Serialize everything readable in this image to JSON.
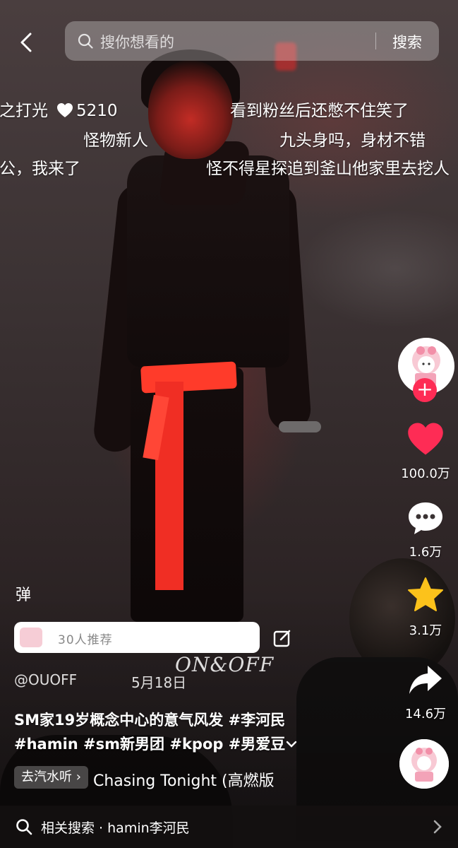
{
  "search": {
    "placeholder": "搜你想看的",
    "button_label": "搜索"
  },
  "danmaku": [
    {
      "text": "神之打光",
      "likes": "5210"
    },
    {
      "text": "看到粉丝后还憋不住笑了"
    },
    {
      "text": "怪物新人"
    },
    {
      "text": "九头身吗，身材不错"
    },
    {
      "text": "老公，我来了"
    },
    {
      "text": "怪不得星探追到釜山他家里去挖人"
    }
  ],
  "rail": {
    "likes": "100.0万",
    "comments": "1.6万",
    "favorites": "3.1万",
    "shares": "14.6万"
  },
  "danmu_toggle": "弹",
  "recommend_pill": "30人推荐",
  "watermark": "ON&OFF",
  "author": "@OUOFF",
  "date": "5月18日",
  "caption": {
    "line1": "SM家19岁概念中心的意气风发 #李河民",
    "line2": "#hamin #sm新男团 #kpop #男爱豆"
  },
  "music": {
    "tag": "去汽水听",
    "title": "Chasing Tonight (高燃版"
  },
  "bottom_bar": {
    "label": "相关搜索",
    "query": "hamin李河民"
  },
  "colors": {
    "like_red": "#fe2c55",
    "star_yellow": "#fcc21b",
    "sash_red": "#f02e24"
  },
  "icons": [
    "back-arrow-icon",
    "search-icon",
    "heart-icon",
    "comment-icon",
    "star-icon",
    "share-icon",
    "plus-icon",
    "edit-icon",
    "chevron-right-icon",
    "chevron-down-icon"
  ]
}
